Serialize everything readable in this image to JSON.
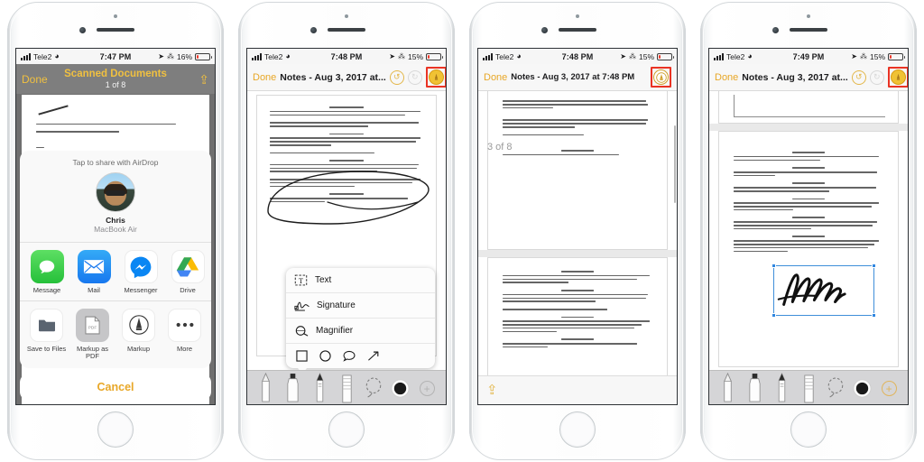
{
  "phones": [
    {
      "id": "phone-1-share-sheet",
      "status": {
        "carrier": "Tele2",
        "wifi": "wifi-icon",
        "time": "7:47 PM",
        "location": "location-icon",
        "bluetooth": "bluetooth-icon",
        "battery_pct": "16%",
        "battery_color": "#ef3b2d",
        "battery_level": 16
      },
      "nav": {
        "done": "Done",
        "title": "Scanned Documents",
        "subtitle": "1 of 8",
        "share_icon": "share-up-icon"
      },
      "airdrop": {
        "header": "Tap to share with AirDrop",
        "person_name": "Chris",
        "person_device": "MacBook Air",
        "avatar": "contact-photo"
      },
      "apps": [
        {
          "label": "Message",
          "icon": "messages-icon"
        },
        {
          "label": "Mail",
          "icon": "mail-icon"
        },
        {
          "label": "Messenger",
          "icon": "messenger-icon"
        },
        {
          "label": "Drive",
          "icon": "google-drive-icon"
        },
        {
          "label": "",
          "icon": "partial-app-icon"
        }
      ],
      "actions": [
        {
          "label": "Save to Files",
          "icon": "folder-icon"
        },
        {
          "label": "Markup as PDF",
          "icon": "pdf-document-icon",
          "selected": true
        },
        {
          "label": "Markup",
          "icon": "markup-pen-icon"
        },
        {
          "label": "More",
          "icon": "ellipsis-icon"
        }
      ],
      "cancel": "Cancel"
    },
    {
      "id": "phone-2-markup-menu",
      "status": {
        "carrier": "Tele2",
        "wifi": "wifi-icon",
        "time": "7:48 PM",
        "location": "location-icon",
        "bluetooth": "bluetooth-icon",
        "battery_pct": "15%",
        "battery_color": "#ef3b2d",
        "battery_level": 15
      },
      "nav": {
        "done": "Done",
        "title": "Notes - Aug 3, 2017 at...",
        "undo": "undo-icon",
        "redo": "redo-icon",
        "markup_pen": "markup-pen-icon",
        "markup_highlight_color": "#ea3323"
      },
      "menu": [
        {
          "label": "Text",
          "icon": "text-box-icon"
        },
        {
          "label": "Signature",
          "icon": "signature-icon"
        },
        {
          "label": "Magnifier",
          "icon": "magnifier-icon"
        }
      ],
      "shapes": [
        {
          "icon": "square-shape-icon"
        },
        {
          "icon": "circle-shape-icon"
        },
        {
          "icon": "speech-bubble-icon"
        },
        {
          "icon": "arrow-shape-icon"
        }
      ],
      "toolbar": [
        {
          "icon": "pen-tool-icon"
        },
        {
          "icon": "highlighter-tool-icon"
        },
        {
          "icon": "pencil-tool-icon"
        },
        {
          "icon": "eraser-tool-icon"
        },
        {
          "icon": "lasso-tool-icon"
        },
        {
          "icon": "color-swatch-icon",
          "color": "#1a1a1a"
        },
        {
          "icon": "add-tool-icon"
        }
      ],
      "annotation": "hand-drawn-ellipse"
    },
    {
      "id": "phone-3-page-indicator",
      "status": {
        "carrier": "Tele2",
        "wifi": "wifi-icon",
        "time": "7:48 PM",
        "location": "location-icon",
        "bluetooth": "bluetooth-icon",
        "battery_pct": "15%",
        "battery_color": "#ef3b2d",
        "battery_level": 15
      },
      "nav": {
        "done": "Done",
        "title": "Notes - Aug 3, 2017 at 7:48 PM",
        "markup_pen": "markup-pen-icon",
        "markup_highlight_color": "#ea3323"
      },
      "page_indicator": "3 of 8",
      "bottom": {
        "share_icon": "share-up-icon"
      }
    },
    {
      "id": "phone-4-signature-placed",
      "status": {
        "carrier": "Tele2",
        "wifi": "wifi-icon",
        "time": "7:49 PM",
        "location": "location-icon",
        "bluetooth": "bluetooth-icon",
        "battery_pct": "15%",
        "battery_color": "#ef3b2d",
        "battery_level": 15
      },
      "nav": {
        "done": "Done",
        "title": "Notes - Aug 3, 2017 at...",
        "undo": "undo-icon",
        "redo": "redo-icon",
        "markup_pen": "markup-pen-icon",
        "markup_highlight_color": "#ea3323"
      },
      "signature": "handwritten-signature",
      "toolbar": [
        {
          "icon": "pen-tool-icon"
        },
        {
          "icon": "highlighter-tool-icon"
        },
        {
          "icon": "pencil-tool-icon"
        },
        {
          "icon": "eraser-tool-icon"
        },
        {
          "icon": "lasso-tool-icon"
        },
        {
          "icon": "color-swatch-icon",
          "color": "#1a1a1a"
        },
        {
          "icon": "add-tool-icon"
        }
      ]
    }
  ]
}
